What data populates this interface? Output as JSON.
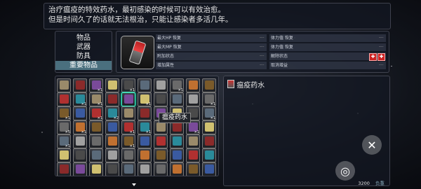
{
  "description": {
    "line1": "治疗瘟疫的特效药水，最初感染的时候可以有效治愈。",
    "line2": "但是时间久了的话就无法根治，只能让感染者多活几年。"
  },
  "categories": [
    {
      "label": "物品"
    },
    {
      "label": "武器"
    },
    {
      "label": "防具"
    },
    {
      "label": "重要物品"
    }
  ],
  "selected_category": "重要物品",
  "stats": {
    "left": [
      "最大HP 恢复",
      "最大MP 恢复",
      "附加状态",
      "增加属性"
    ],
    "right": [
      "体力值 恢复",
      "体力值 恢复",
      "解除状态",
      "取消增益"
    ],
    "placeholder": "---"
  },
  "item_counts": [
    "×1",
    "×1",
    "×1",
    "×1",
    "×1",
    "×1",
    "×1",
    "×1",
    "×1",
    "×2",
    "×1",
    "×1",
    "×5",
    "×1",
    "×1",
    "×1",
    "×1",
    "×1",
    "×1"
  ],
  "tooltip": "瘟疫药水",
  "selected_item": {
    "name": "瘟疫药水"
  },
  "footer": {
    "value": "3200",
    "label": "负重"
  },
  "buttons": {
    "close": "✕",
    "action": "◎"
  },
  "colors": {
    "accent": "#4a6f7e",
    "highlight": "#2e7c8c"
  }
}
